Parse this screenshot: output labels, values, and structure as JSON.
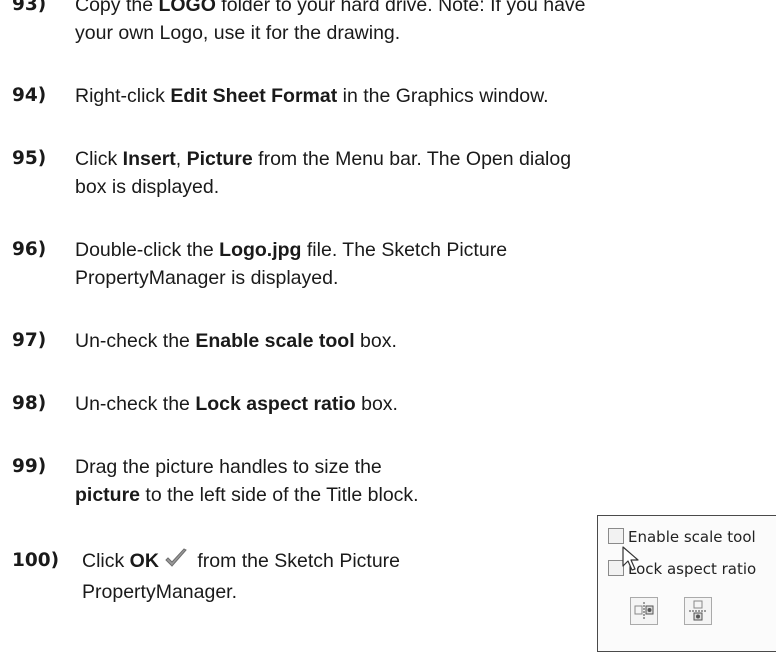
{
  "steps": [
    {
      "number": "93)",
      "line1_prefix": "Copy the ",
      "line1_bold": "LOGO",
      "line1_suffix": " folder to your hard drive. Note: If you have",
      "line2": "your own Logo, use it for the drawing."
    },
    {
      "number": "94)",
      "prefix": "Right-click ",
      "bold": "Edit Sheet Format",
      "suffix": " in the Graphics window."
    },
    {
      "number": "95)",
      "prefix": "Click ",
      "bold1": "Insert",
      "mid": ", ",
      "bold2": "Picture",
      "suffix": " from the Menu bar. The Open dialog",
      "line2": "box is displayed."
    },
    {
      "number": "96)",
      "prefix": "Double-click the ",
      "bold": "Logo.jpg",
      "suffix": " file. The Sketch Picture",
      "line2": "PropertyManager is displayed."
    },
    {
      "number": "97)",
      "prefix": "Un-check the ",
      "bold": "Enable scale tool",
      "suffix": " box."
    },
    {
      "number": "98)",
      "prefix": "Un-check the ",
      "bold": "Lock aspect ratio",
      "suffix": " box."
    },
    {
      "number": "99)",
      "line1": "Drag the picture handles to size the",
      "line2_bold": "picture",
      "line2_suffix": " to the left side of the Title block."
    },
    {
      "number": "100)",
      "prefix": "Click ",
      "bold": "OK",
      "suffix": " from the Sketch Picture",
      "line2": "PropertyManager."
    }
  ],
  "panel": {
    "options": [
      {
        "label": "Enable scale tool",
        "checked": false
      },
      {
        "label": "Lock aspect ratio",
        "checked": false
      }
    ],
    "icons": [
      "picture-flip-horizontal-icon",
      "picture-flip-vertical-icon"
    ]
  },
  "colors": {
    "ok_check": "#8a8a8a"
  }
}
